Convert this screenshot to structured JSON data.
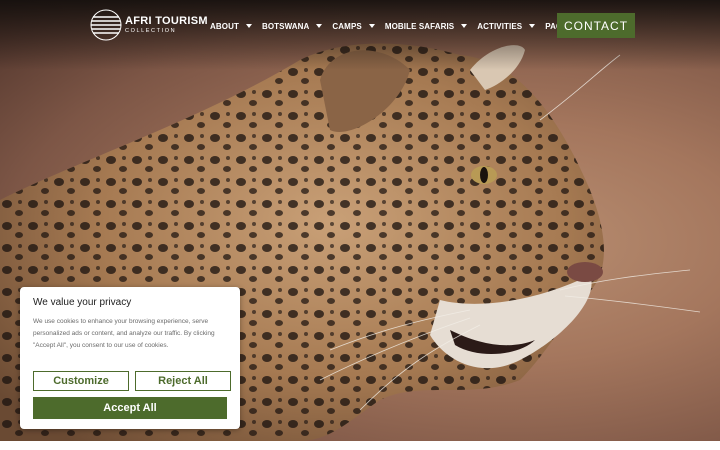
{
  "header": {
    "logo_title": "AFRI TOURISM",
    "logo_subtitle": "COLLECTION",
    "nav": [
      {
        "label": "ABOUT",
        "has_dropdown": true
      },
      {
        "label": "BOTSWANA",
        "has_dropdown": true
      },
      {
        "label": "CAMPS",
        "has_dropdown": true
      },
      {
        "label": "MOBILE SAFARIS",
        "has_dropdown": true
      },
      {
        "label": "ACTIVITIES",
        "has_dropdown": true
      },
      {
        "label": "PACKAGES",
        "has_dropdown": false
      }
    ],
    "contact_label": "CONTACT"
  },
  "hero": {
    "image_subject": "leopard-profile-photo"
  },
  "cookie_banner": {
    "title": "We value your privacy",
    "text": "We use cookies to enhance your browsing experience, serve personalized ads or content, and analyze our traffic. By clicking \"Accept All\", you consent to our use of cookies.",
    "customize_label": "Customize",
    "reject_label": "Reject All",
    "accept_label": "Accept All"
  },
  "colors": {
    "brand_green": "#4d6b2c",
    "text_dark": "#212121",
    "text_muted": "#6b6b6b"
  }
}
